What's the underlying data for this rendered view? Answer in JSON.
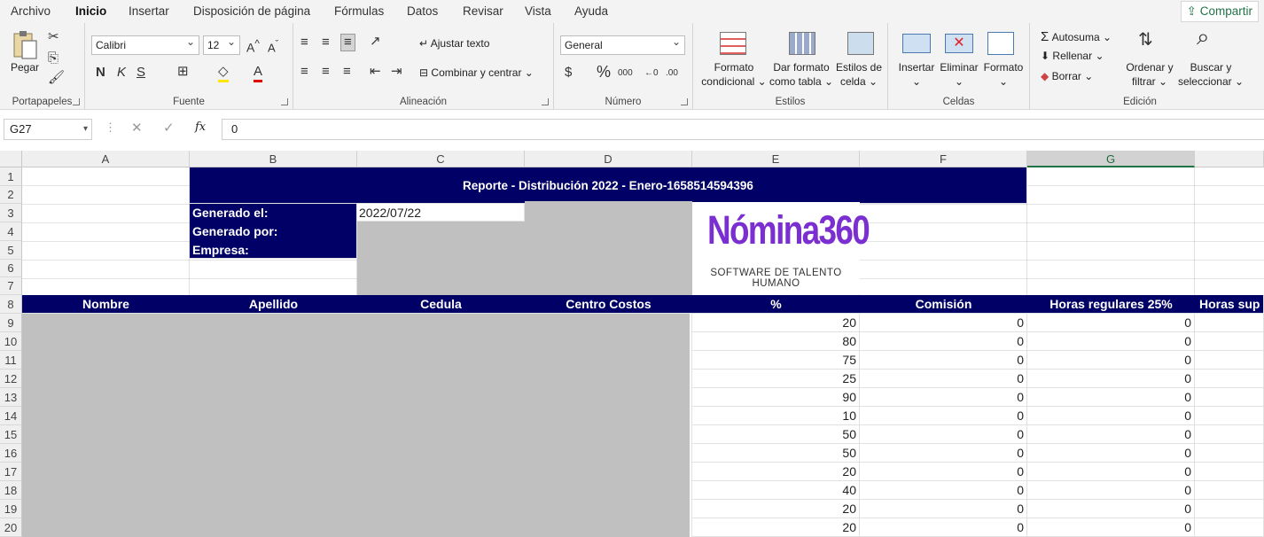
{
  "tabs": [
    "Archivo",
    "Inicio",
    "Insertar",
    "Disposición de página",
    "Fórmulas",
    "Datos",
    "Revisar",
    "Vista",
    "Ayuda"
  ],
  "share_label": "Compartir",
  "ribbon": {
    "clipboard": {
      "label": "Portapapeles",
      "paste": "Pegar"
    },
    "font": {
      "label": "Fuente",
      "name": "Calibri",
      "size": "12",
      "bold": "N",
      "italic": "K",
      "underline": "S"
    },
    "alignment": {
      "label": "Alineación",
      "wrap": "Ajustar texto",
      "merge": "Combinar y centrar"
    },
    "number": {
      "label": "Número",
      "format": "General"
    },
    "styles": {
      "label": "Estilos",
      "cond1": "Formato",
      "cond2": "condicional",
      "table1": "Dar formato",
      "table2": "como tabla",
      "cell1": "Estilos de",
      "cell2": "celda"
    },
    "cells": {
      "label": "Celdas",
      "insert": "Insertar",
      "delete": "Eliminar",
      "format": "Formato"
    },
    "editing": {
      "label": "Edición",
      "autosum": "Autosuma",
      "fill": "Rellenar",
      "clear": "Borrar",
      "sort1": "Ordenar y",
      "sort2": "filtrar",
      "find1": "Buscar y",
      "find2": "seleccionar"
    }
  },
  "formula_bar": {
    "name_box": "G27",
    "value": "0",
    "fx": "fx"
  },
  "columns": [
    "A",
    "B",
    "C",
    "D",
    "E",
    "F",
    "G"
  ],
  "rows": [
    "1",
    "2",
    "3",
    "4",
    "5",
    "6",
    "7",
    "8",
    "9",
    "10",
    "11",
    "12",
    "13",
    "14",
    "15",
    "16",
    "17",
    "18",
    "19",
    "20"
  ],
  "sheet": {
    "title": "Reporte - Distribución 2022 - Enero-1658514594396",
    "generated_on_label": "Generado el:",
    "generated_on_value": "2022/07/22",
    "generated_by_label": "Generado por:",
    "company_label": "Empresa:",
    "logo_text": "Nómina360",
    "logo_tagline": "SOFTWARE DE TALENTO HUMANO",
    "headers": [
      "Nombre",
      "Apellido",
      "Cedula",
      "Centro Costos",
      "%",
      "Comisión",
      "Horas regulares 25%",
      "Horas sup"
    ],
    "percent_values": [
      "20",
      "80",
      "75",
      "25",
      "90",
      "10",
      "50",
      "50",
      "20",
      "40",
      "20",
      "20"
    ],
    "commission_values": [
      "0",
      "0",
      "0",
      "0",
      "0",
      "0",
      "0",
      "0",
      "0",
      "0",
      "0",
      "0"
    ],
    "hours_values": [
      "0",
      "0",
      "0",
      "0",
      "0",
      "0",
      "0",
      "0",
      "0",
      "0",
      "0",
      "0"
    ]
  },
  "colors": {
    "accent": "#217346",
    "header_navy": "#000066",
    "logo_purple": "#7b2fd0",
    "redacted_gray": "#c0c0c0"
  }
}
